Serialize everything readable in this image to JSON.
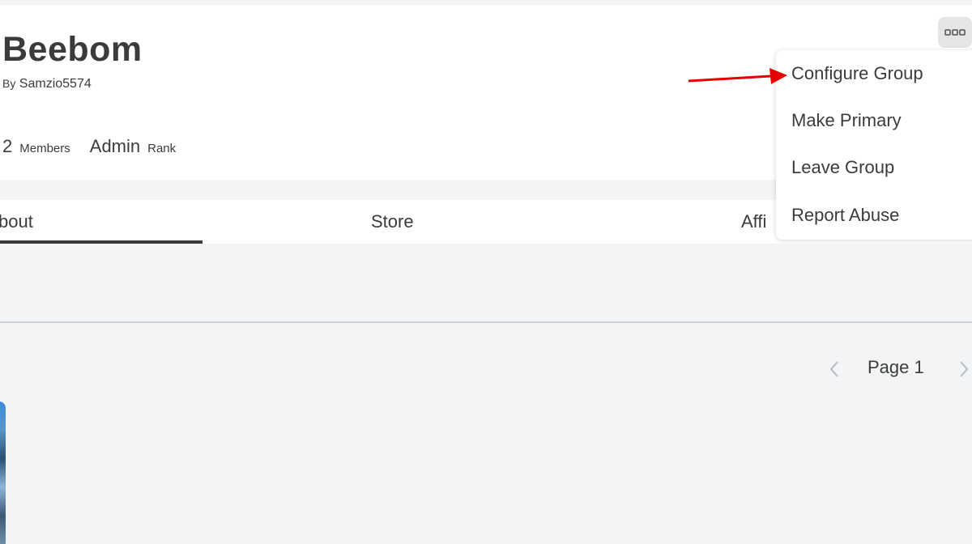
{
  "header": {
    "group_name": "Beebom",
    "by_label": "By",
    "owner": "Samzio5574",
    "members_count": "2",
    "members_label": "Members",
    "rank_value": "Admin",
    "rank_label": "Rank"
  },
  "tabs": [
    {
      "label": "About",
      "visible_text": "bout",
      "selected": true
    },
    {
      "label": "Store",
      "visible_text": "Store",
      "selected": false
    },
    {
      "label": "Affiliates",
      "visible_text": "Affi",
      "selected": false
    }
  ],
  "menu": {
    "items": [
      {
        "label": "Configure Group"
      },
      {
        "label": "Make Primary"
      },
      {
        "label": "Leave Group"
      },
      {
        "label": "Report Abuse"
      }
    ]
  },
  "pager": {
    "text": "Page 1"
  },
  "colors": {
    "background": "#f2f4f5",
    "card": "#ffffff",
    "text": "#393b3d",
    "annotation_arrow": "#e60000"
  },
  "icons": {
    "more": "more-dots-icon",
    "prev": "chevron-left-icon",
    "next": "chevron-right-icon",
    "annotation": "red-arrow-icon"
  }
}
